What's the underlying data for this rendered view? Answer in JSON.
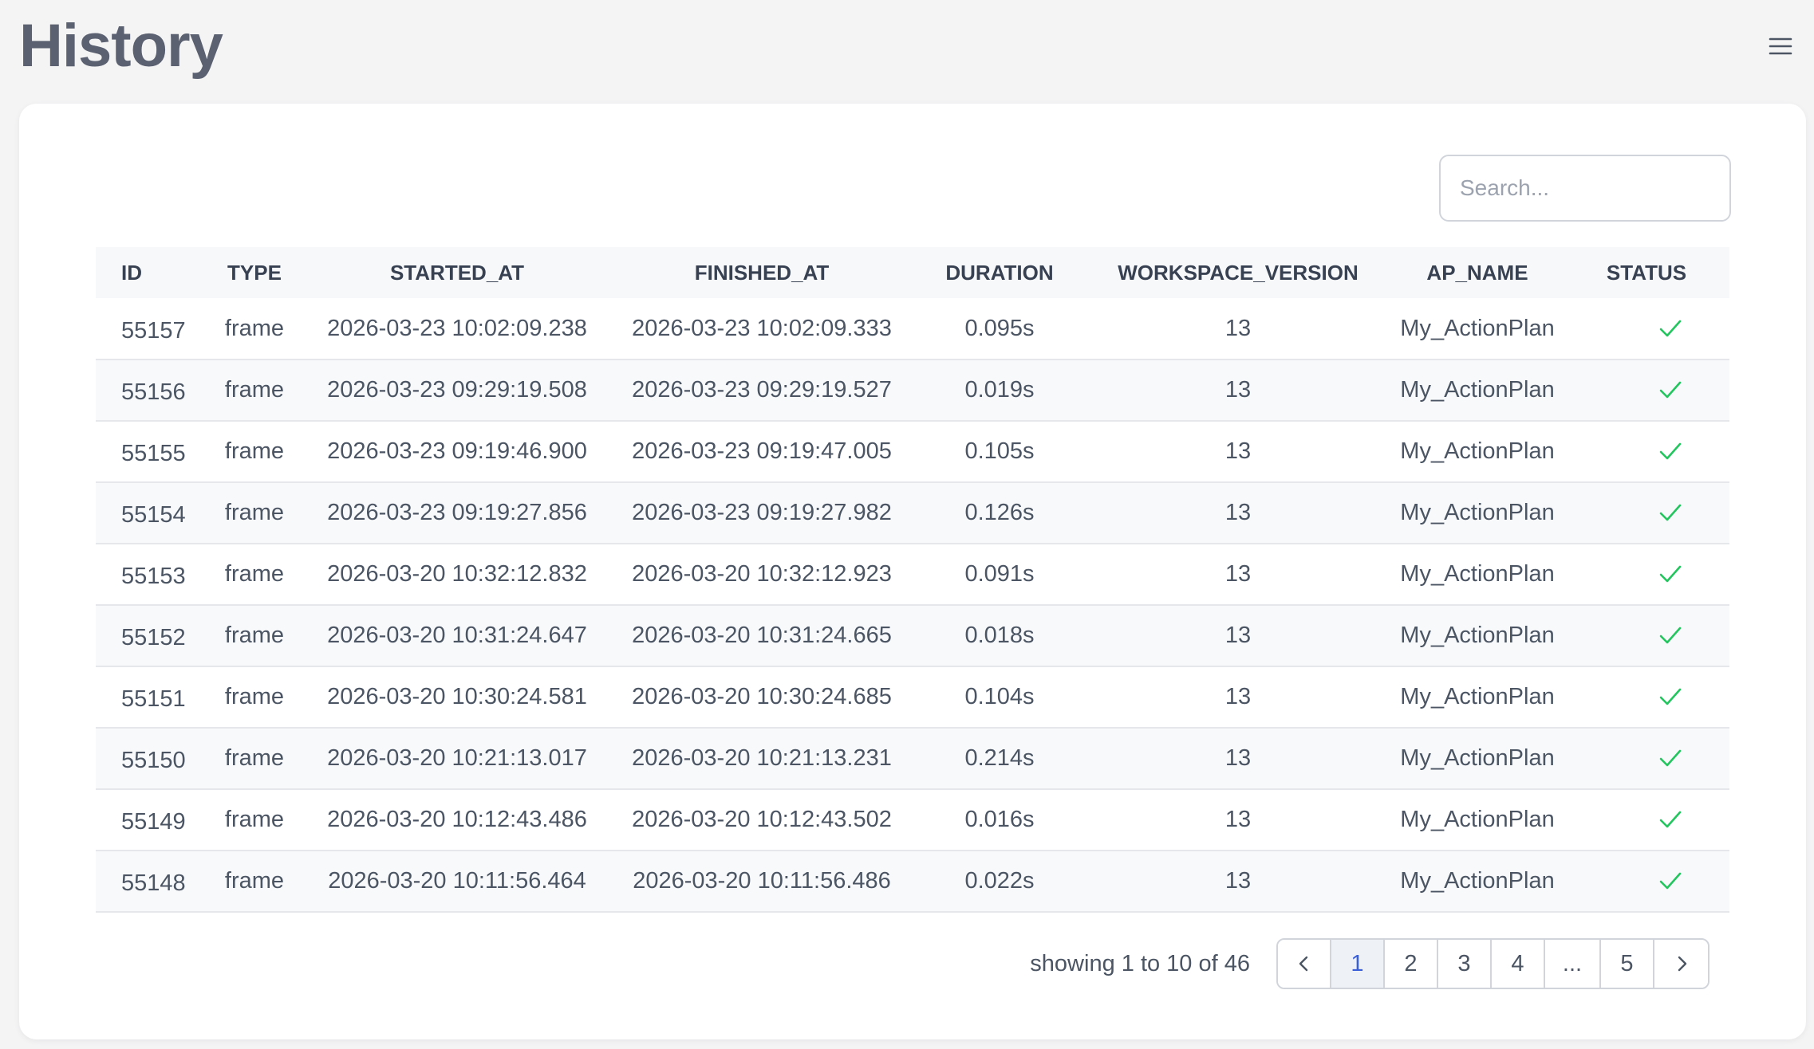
{
  "header": {
    "title": "History",
    "menu_icon": "hamburger-menu-icon"
  },
  "search": {
    "placeholder": "Search..."
  },
  "table": {
    "columns": [
      "ID",
      "TYPE",
      "STARTED_AT",
      "FINISHED_AT",
      "DURATION",
      "WORKSPACE_VERSION",
      "AP_NAME",
      "STATUS"
    ],
    "rows": [
      {
        "id": "55157",
        "type": "frame",
        "started_at": "2026-03-23 10:02:09.238",
        "finished_at": "2026-03-23 10:02:09.333",
        "duration": "0.095s",
        "workspace_version": "13",
        "ap_name": "My_ActionPlan",
        "status": "success"
      },
      {
        "id": "55156",
        "type": "frame",
        "started_at": "2026-03-23 09:29:19.508",
        "finished_at": "2026-03-23 09:29:19.527",
        "duration": "0.019s",
        "workspace_version": "13",
        "ap_name": "My_ActionPlan",
        "status": "success"
      },
      {
        "id": "55155",
        "type": "frame",
        "started_at": "2026-03-23 09:19:46.900",
        "finished_at": "2026-03-23 09:19:47.005",
        "duration": "0.105s",
        "workspace_version": "13",
        "ap_name": "My_ActionPlan",
        "status": "success"
      },
      {
        "id": "55154",
        "type": "frame",
        "started_at": "2026-03-23 09:19:27.856",
        "finished_at": "2026-03-23 09:19:27.982",
        "duration": "0.126s",
        "workspace_version": "13",
        "ap_name": "My_ActionPlan",
        "status": "success"
      },
      {
        "id": "55153",
        "type": "frame",
        "started_at": "2026-03-20 10:32:12.832",
        "finished_at": "2026-03-20 10:32:12.923",
        "duration": "0.091s",
        "workspace_version": "13",
        "ap_name": "My_ActionPlan",
        "status": "success"
      },
      {
        "id": "55152",
        "type": "frame",
        "started_at": "2026-03-20 10:31:24.647",
        "finished_at": "2026-03-20 10:31:24.665",
        "duration": "0.018s",
        "workspace_version": "13",
        "ap_name": "My_ActionPlan",
        "status": "success"
      },
      {
        "id": "55151",
        "type": "frame",
        "started_at": "2026-03-20 10:30:24.581",
        "finished_at": "2026-03-20 10:30:24.685",
        "duration": "0.104s",
        "workspace_version": "13",
        "ap_name": "My_ActionPlan",
        "status": "success"
      },
      {
        "id": "55150",
        "type": "frame",
        "started_at": "2026-03-20 10:21:13.017",
        "finished_at": "2026-03-20 10:21:13.231",
        "duration": "0.214s",
        "workspace_version": "13",
        "ap_name": "My_ActionPlan",
        "status": "success"
      },
      {
        "id": "55149",
        "type": "frame",
        "started_at": "2026-03-20 10:12:43.486",
        "finished_at": "2026-03-20 10:12:43.502",
        "duration": "0.016s",
        "workspace_version": "13",
        "ap_name": "My_ActionPlan",
        "status": "success"
      },
      {
        "id": "55148",
        "type": "frame",
        "started_at": "2026-03-20 10:11:56.464",
        "finished_at": "2026-03-20 10:11:56.486",
        "duration": "0.022s",
        "workspace_version": "13",
        "ap_name": "My_ActionPlan",
        "status": "success"
      }
    ],
    "status_icon": "checkmark-icon",
    "status_color": "#22c55e"
  },
  "pagination": {
    "summary": "showing 1 to 10 of 46",
    "prev_icon": "chevron-left-icon",
    "next_icon": "chevron-right-icon",
    "pages": [
      "1",
      "2",
      "3",
      "4",
      "...",
      "5"
    ],
    "current_page": "1",
    "active_color": "#3b5fd9"
  }
}
